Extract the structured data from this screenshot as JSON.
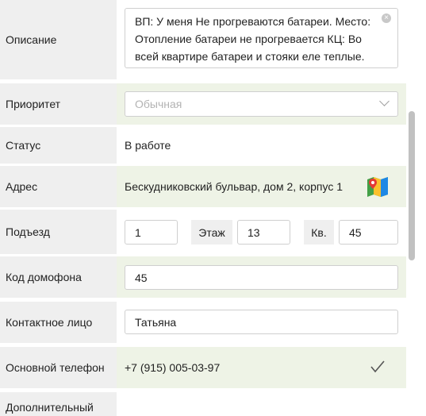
{
  "rows": {
    "description": {
      "label": "Описание",
      "value": "ВП: У меня Не прогреваются батареи. Место: Отопление батареи не прогревается КЦ: Во всей квартире батареи и стояки еле теплые."
    },
    "priority": {
      "label": "Приоритет",
      "value": "Обычная"
    },
    "status": {
      "label": "Статус",
      "value": "В работе"
    },
    "address": {
      "label": "Адрес",
      "value": "Бескудниковский бульвар, дом 2, корпус 1",
      "icon": "map-icon"
    },
    "entrance": {
      "label": "Подъезд",
      "value": "1",
      "floor_label": "Этаж",
      "floor_value": "13",
      "apt_label": "Кв.",
      "apt_value": "45"
    },
    "intercom": {
      "label": "Код домофона",
      "value": "45"
    },
    "contact": {
      "label": "Контактное лицо",
      "value": "Татьяна"
    },
    "phone": {
      "label": "Основной телефон",
      "value": "+7 (915) 005-03-97",
      "icon": "checkmark-icon"
    },
    "extra": {
      "label": "Дополнительный"
    }
  },
  "colors": {
    "label_bg": "#efefef",
    "green_bg": "#eef3e6",
    "border": "#cfcfcf"
  }
}
